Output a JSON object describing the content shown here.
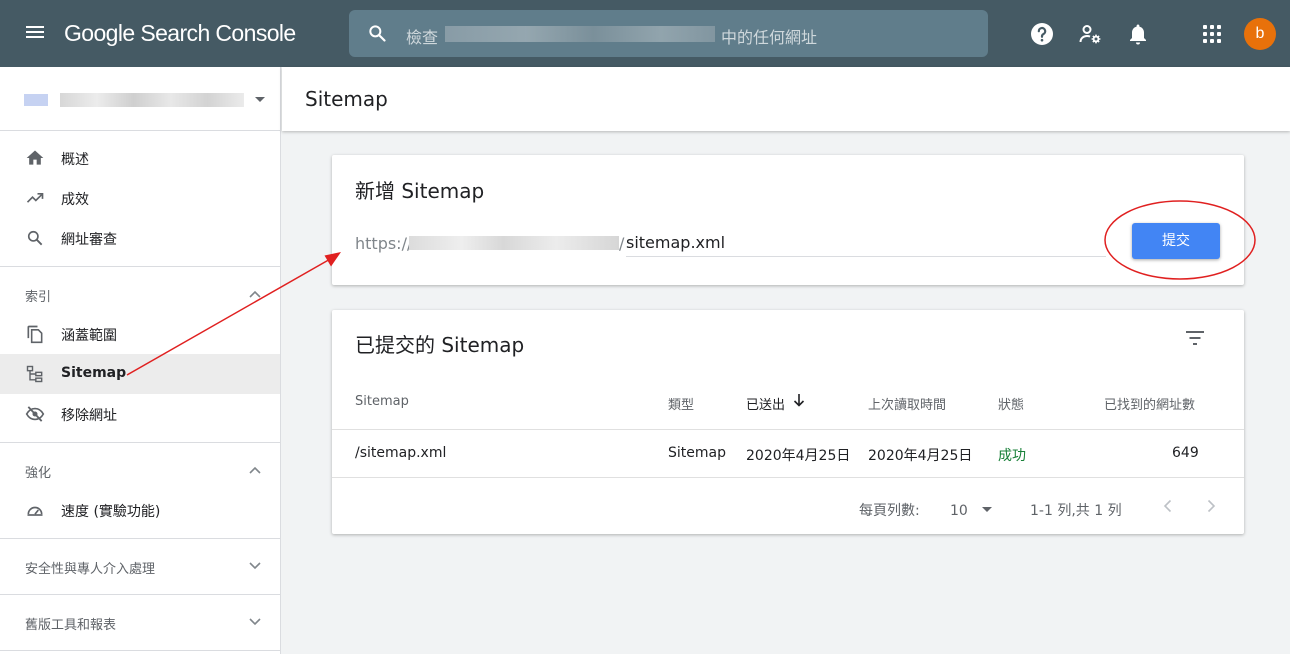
{
  "header": {
    "app_name": "Google Search Console",
    "search": {
      "prefix": "檢查",
      "suffix": "中的任何網址"
    },
    "avatar_letter": "b",
    "avatar_color": "#e8710a",
    "bar_color": "#455a64"
  },
  "sidebar": {
    "items_top": [
      {
        "label": "概述",
        "icon": "home-icon"
      },
      {
        "label": "成效",
        "icon": "trending-up-icon"
      },
      {
        "label": "網址審查",
        "icon": "search-icon"
      }
    ],
    "section_index": {
      "label": "索引",
      "expanded": true,
      "items": [
        {
          "label": "涵蓋範圍",
          "icon": "file-copy-icon"
        },
        {
          "label": "Sitemap",
          "icon": "sitemap-icon",
          "active": true
        },
        {
          "label": "移除網址",
          "icon": "visibility-off-icon"
        }
      ]
    },
    "section_enhance": {
      "label": "強化",
      "expanded": true,
      "items": [
        {
          "label": "速度 (實驗功能)",
          "icon": "speedometer-icon"
        }
      ]
    },
    "section_security": {
      "label": "安全性與專人介入處理",
      "expanded": false
    },
    "section_legacy": {
      "label": "舊版工具和報表",
      "expanded": false
    }
  },
  "main": {
    "page_title": "Sitemap",
    "add_card": {
      "title": "新增 Sitemap",
      "url_prefix": "https://",
      "url_slash": "/",
      "input_value": "sitemap.xml",
      "submit_label": "提交"
    },
    "submitted_card": {
      "title": "已提交的 Sitemap",
      "columns": [
        "Sitemap",
        "類型",
        "已送出",
        "上次讀取時間",
        "狀態",
        "已找到的網址數"
      ],
      "rows": [
        {
          "sitemap": "/sitemap.xml",
          "type": "Sitemap",
          "submitted": "2020年4月25日",
          "last_read": "2020年4月25日",
          "status": "成功",
          "urls_found": "649"
        }
      ],
      "footer": {
        "rows_per_page_label": "每頁列數:",
        "rows_per_page_value": "10",
        "range_text": "1-1 列,共 1 列"
      }
    }
  },
  "colors": {
    "accent": "#4285f4",
    "success": "#188038",
    "annotation": "#e02020"
  }
}
